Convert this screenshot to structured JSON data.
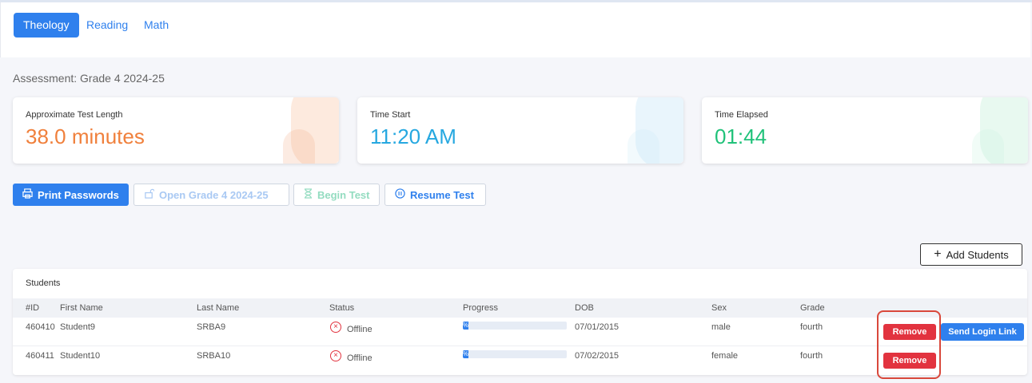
{
  "tabs": [
    {
      "label": "Theology",
      "active": true
    },
    {
      "label": "Reading",
      "active": false
    },
    {
      "label": "Math",
      "active": false
    }
  ],
  "assessment": "Assessment: Grade 4 2024-25",
  "cards": {
    "test_length": {
      "label": "Approximate Test Length",
      "value": "38.0 minutes",
      "color": "#f0803c"
    },
    "time_start": {
      "label": "Time Start",
      "value": "11:20 AM",
      "color": "#26a8e0"
    },
    "time_elapsed": {
      "label": "Time Elapsed",
      "value": "01:44",
      "color": "#21c27a"
    }
  },
  "actions": {
    "print": "Print Passwords",
    "open": "Open Grade 4 2024-25",
    "begin": "Begin Test",
    "resume": "Resume Test"
  },
  "add_students": "Add Students",
  "table": {
    "title": "Students",
    "headers": [
      "#ID",
      "First Name",
      "Last Name",
      "Status",
      "Progress",
      "DOB",
      "Sex",
      "Grade"
    ],
    "rows": [
      {
        "id": "460410",
        "first": "Student9",
        "last": "SRBA9",
        "status": "Offline",
        "progress": "%",
        "progress_fraction": 0.05,
        "dob": "07/01/2015",
        "sex": "male",
        "grade": "fourth",
        "remove": "Remove",
        "login": "Send Login Link"
      },
      {
        "id": "460411",
        "first": "Student10",
        "last": "SRBA10",
        "status": "Offline",
        "progress": "%",
        "progress_fraction": 0.05,
        "dob": "07/02/2015",
        "sex": "female",
        "grade": "fourth",
        "remove": "Remove"
      }
    ]
  },
  "colors": {
    "accent": "#2f80ed",
    "danger": "#e2333f",
    "highlight": "#d9483b"
  }
}
